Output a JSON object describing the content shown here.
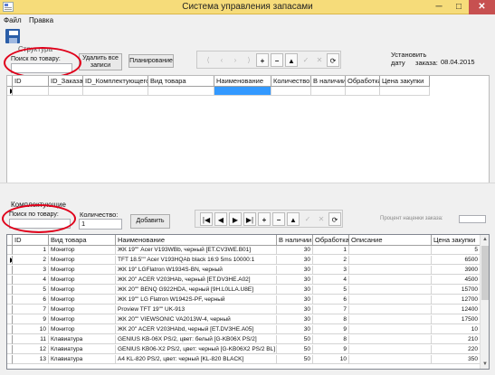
{
  "window": {
    "title": "Система управления запасами",
    "minimize": "─",
    "maximize": "□",
    "close": "✕"
  },
  "menu": [
    "Файл",
    "Правка"
  ],
  "toolbar": {
    "save_icon": "save-icon"
  },
  "top": {
    "group_title": "Структура",
    "search_label": "Поиск по товару:",
    "delete_all": "Удалить все записи",
    "planning": "Планирование",
    "set_date_label": "Установить дату",
    "order_label": "заказа:",
    "order_date": "08.04.2015",
    "nav_buttons": [
      "⟨",
      "‹",
      "›",
      "⟩",
      "+",
      "−",
      "▲",
      "✓",
      "✕",
      "⟳"
    ],
    "columns": [
      "ID",
      "ID_Заказа",
      "ID_Комплектующего",
      "Вид товара",
      "Наименование",
      "Количество",
      "В наличии",
      "Обработка",
      "Цена закупки"
    ]
  },
  "bottom": {
    "group_title": "Комплектующие",
    "search_label": "Поиск по товару:",
    "qty_label": "Количество:",
    "qty_value": "1",
    "add": "Добавить",
    "total_label": "Процент наценки заказа:",
    "nav_buttons": [
      "|◀",
      "◀",
      "▶",
      "▶|",
      "+",
      "−",
      "▲",
      "✓",
      "✕",
      "⟳"
    ],
    "columns": [
      "ID",
      "Вид товара",
      "Наименование",
      "В наличии",
      "Обработка",
      "Описание",
      "Цена закупки"
    ],
    "rows": [
      [
        "1",
        "Монитор",
        "ЖК 19\"\" Acer V193WBb, черный [ET.CV3WE.B01]",
        "30",
        "1",
        "",
        "5"
      ],
      [
        "2",
        "Монитор",
        "TFT 18.5\"\" Acer V193HQAb black 16:9 5ms 10000:1",
        "30",
        "2",
        "",
        "6500"
      ],
      [
        "3",
        "Монитор",
        "ЖК 19\" LGFlatron W1934S-BN, черный",
        "30",
        "3",
        "",
        "3900"
      ],
      [
        "4",
        "Монитор",
        "ЖК 20\" ACER V203HAb, черный [ET.DV3HE.A02]",
        "30",
        "4",
        "",
        "4500"
      ],
      [
        "5",
        "Монитор",
        "ЖК 20\"\" BENQ G922HDA, черный [9H.L0LLA.U8E]",
        "30",
        "5",
        "",
        "15700"
      ],
      [
        "6",
        "Монитор",
        "ЖК 19\"\" LG Flatron W1942S-PF, черный",
        "30",
        "6",
        "",
        "12700"
      ],
      [
        "7",
        "Монитор",
        "Proview TFT 19\"\" UK-913",
        "30",
        "7",
        "",
        "12400"
      ],
      [
        "9",
        "Монитор",
        "ЖК 20\"\" VIEWSONIC VA2013W-4, черный",
        "30",
        "8",
        "",
        "17500"
      ],
      [
        "10",
        "Монитор",
        "ЖК 20\" ACER V203HAbd, черный [ET.DV3HE.A05]",
        "30",
        "9",
        "",
        "10"
      ],
      [
        "11",
        "Клавиатура",
        "GENIUS KB-06X PS/2, цвет: белый [G-KB06X PS/2]",
        "50",
        "8",
        "",
        "210"
      ],
      [
        "12",
        "Клавиатура",
        "GENIUS KB06-X2 PS/2, цвет: черный [G-KB06X2 PS/2 BL]",
        "50",
        "9",
        "",
        "220"
      ],
      [
        "13",
        "Клавиатура",
        "A4 KL-820 PS/2, цвет: черный [KL-820 BLACK]",
        "50",
        "10",
        "",
        "350"
      ]
    ]
  },
  "colors": {
    "titlebar": "#f6dc7a",
    "selected_header": "#3399ff",
    "annotation": "#e0001a"
  }
}
